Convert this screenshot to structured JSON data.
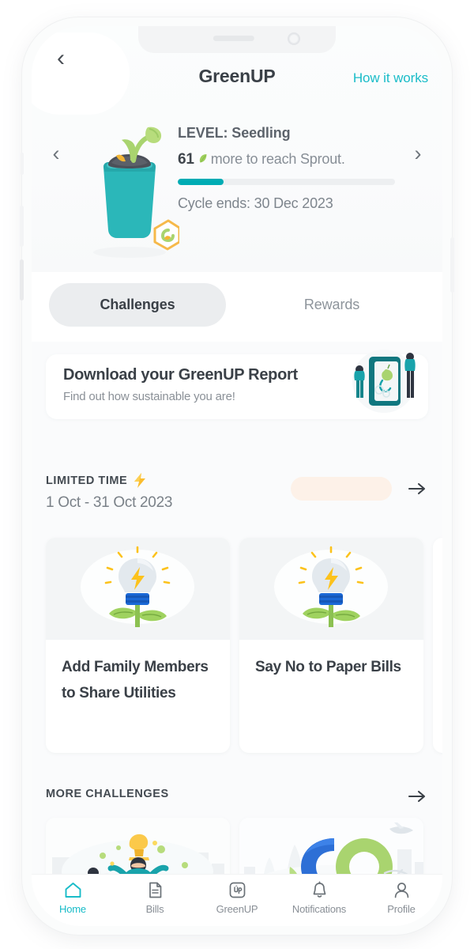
{
  "phone": {
    "notch": {
      "speaker": "speaker-grille",
      "camera": "front-camera"
    }
  },
  "appbar": {
    "back_icon": "chevron-left-icon",
    "title": "GreenUP",
    "action_link": "How it works",
    "accent": "#19bcc8"
  },
  "level": {
    "prev_icon": "chevron-left-icon",
    "next_icon": "chevron-right-icon",
    "illustration": "potted-seedling-illustration",
    "badge_icon": "leaf-hexagon-badge-icon",
    "title": "LEVEL: Seedling",
    "points_value": "61",
    "points_icon": "green-leaf-icon",
    "points_suffix": "more to reach Sprout.",
    "progress_percent": 21,
    "progress_color": "#00acb4",
    "cycle_ends": "Cycle ends: 30 Dec 2023"
  },
  "tabs": [
    {
      "label": "Challenges",
      "active": true
    },
    {
      "label": "Rewards",
      "active": false
    }
  ],
  "report_card": {
    "title": "Download your GreenUP Report",
    "subtitle": "Find out how sustainable you are!",
    "illustration": "people-with-phone-report-illustration"
  },
  "limited_time": {
    "label": "LIMITED TIME",
    "label_icon": "lightning-bolt-icon",
    "dates": "1 Oct - 31 Oct 2023",
    "pill_placeholder": "",
    "pill_color": "#fdf1e8",
    "arrow_icon": "arrow-right-icon",
    "cards": [
      {
        "title": "Add Family Members to Share Utilities",
        "illustration": "lightbulb-plant-illustration"
      },
      {
        "title": "Say No to Paper Bills",
        "illustration": "lightbulb-plant-illustration"
      }
    ]
  },
  "more_challenges": {
    "label": "MORE CHALLENGES",
    "arrow_icon": "arrow-right-icon",
    "cards": [
      {
        "illustration": "superhero-trophy-celebration-illustration"
      },
      {
        "illustration": "co2-emissions-illustration"
      }
    ]
  },
  "bottom_nav": [
    {
      "label": "Home",
      "icon": "home-icon",
      "active": true
    },
    {
      "label": "Bills",
      "icon": "document-icon",
      "active": false
    },
    {
      "label": "GreenUP",
      "icon": "greenup-square-icon",
      "active": false
    },
    {
      "label": "Notifications",
      "icon": "bell-icon",
      "active": false
    },
    {
      "label": "Profile",
      "icon": "person-icon",
      "active": false
    }
  ]
}
